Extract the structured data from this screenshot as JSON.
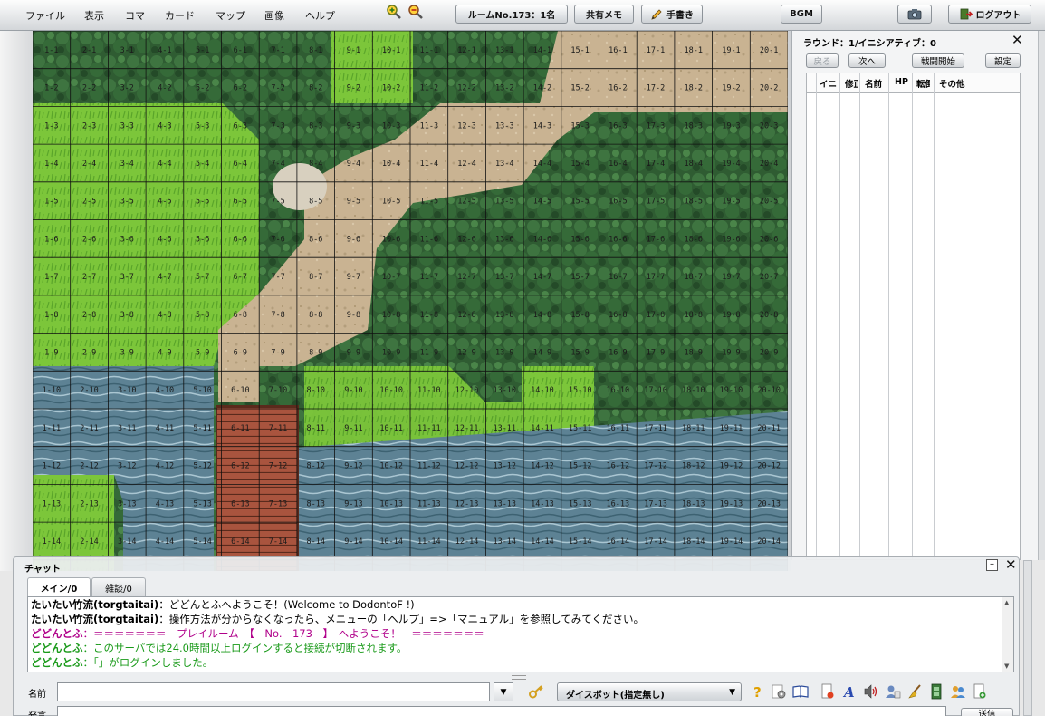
{
  "menu": {
    "items": [
      "ファイル",
      "表示",
      "コマ",
      "カード",
      "マップ",
      "画像",
      "ヘルプ"
    ]
  },
  "toolbar": {
    "room_label": "ルームNo.173：1名",
    "shared_memo_label": "共有メモ",
    "handwriting_label": "手書き",
    "bgm_label": "BGM",
    "logout_label": "ログアウト"
  },
  "map": {
    "columns": 20,
    "rows": 14
  },
  "initiative": {
    "title": "ラウンド：1/イニシアティブ：0",
    "back_label": "戻る",
    "next_label": "次へ",
    "battle_start_label": "戦闘開始",
    "settings_label": "設定",
    "columns": [
      "イニ",
      "修正",
      "名前",
      "HP",
      "転倒",
      "その他"
    ]
  },
  "chat": {
    "title": "チャット",
    "tabs": [
      {
        "label": "メイン/0"
      },
      {
        "label": "雑談/0"
      }
    ],
    "log": [
      {
        "speaker": "たいたい竹流(torgtaitai)",
        "text": "：どどんとふへようこそ！(Welcome to DodontoF !)",
        "color": "#000000"
      },
      {
        "speaker": "たいたい竹流(torgtaitai)",
        "text": "：操作方法が分からなくなったら、メニューの「ヘルプ」=>「マニュアル」を参照してみてください。",
        "color": "#000000"
      },
      {
        "speaker": "どどんとふ",
        "text": "：＝＝＝＝＝＝＝　プレイルーム　【　No.　173　】　へようこそ！　＝＝＝＝＝＝＝",
        "color": "#b0008a"
      },
      {
        "speaker": "どどんとふ",
        "text": "：このサーバでは24.0時間以上ログインすると接続が切断されます。",
        "color": "#1a9a1a"
      },
      {
        "speaker": "どどんとふ",
        "text": "：「」がログインしました。",
        "color": "#1a9a1a"
      }
    ],
    "name_label": "名前",
    "message_label": "発言",
    "name_value": "",
    "message_value": "",
    "dice_system": "ダイスボット(指定無し)",
    "send_label": "送信"
  }
}
